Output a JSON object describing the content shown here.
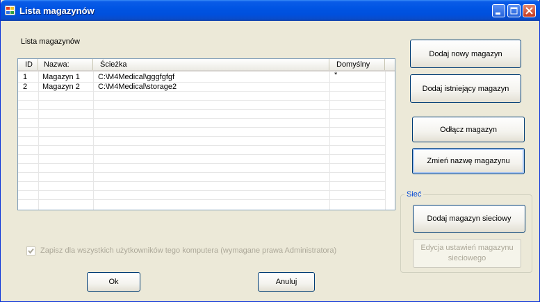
{
  "window": {
    "title": "Lista magazynów"
  },
  "panel": {
    "label": "Lista magazynów"
  },
  "table": {
    "columns": [
      "ID",
      "Nazwa:",
      "Ścieżka",
      "Domyślny"
    ],
    "rows": [
      {
        "id": "1",
        "name": "Magazyn 1",
        "path": "C:\\M4Medical\\gggfgfgf",
        "default": "*"
      },
      {
        "id": "2",
        "name": "Magazyn 2",
        "path": "C:\\M4Medical\\storage2",
        "default": ""
      }
    ]
  },
  "buttons": {
    "add_new": "Dodaj nowy magazyn",
    "add_existing": "Dodaj istniejący magazyn",
    "detach": "Odłącz magazyn",
    "rename": "Zmień nazwę magazynu",
    "add_network": "Dodaj magazyn sieciowy",
    "edit_network_line1": "Edycja ustawień magazynu",
    "edit_network_line2": "sieciowego",
    "ok": "Ok",
    "cancel": "Anuluj"
  },
  "network_group": {
    "title": "Sieć"
  },
  "checkbox": {
    "label": "Zapisz dla wszystkich użytkowników tego komputera (wymagane prawa Administratora)",
    "checked": true,
    "enabled": false
  }
}
